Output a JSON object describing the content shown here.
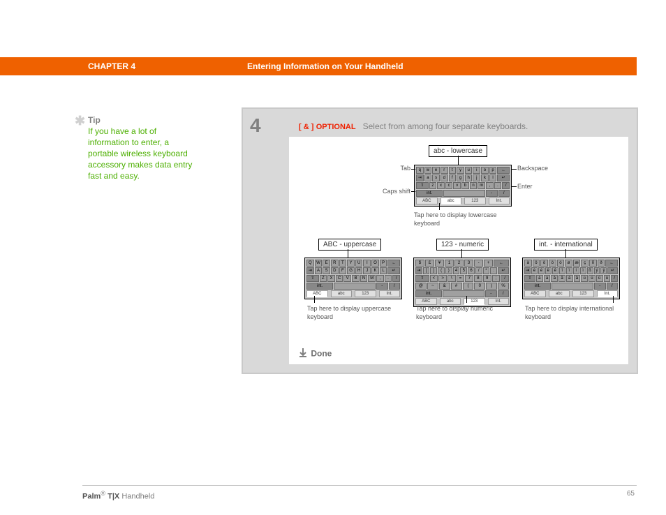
{
  "header": {
    "chapter": "CHAPTER 4",
    "title": "Entering Information on Your Handheld"
  },
  "tip": {
    "heading": "Tip",
    "body": "If you have a lot of information to enter, a portable wireless keyboard accessory makes data entry fast and easy."
  },
  "step": {
    "number": "4",
    "opt_bracket": "[ & ]",
    "opt_word": "OPTIONAL",
    "opt_text": "Select from among four separate keyboards.",
    "done": "Done"
  },
  "labels": {
    "lowercase": "abc - lowercase",
    "uppercase": "ABC - uppercase",
    "numeric": "123 - numeric",
    "international": "int. - international",
    "tab": "Tab",
    "backspace": "Backspace",
    "caps": "Caps shift",
    "enter": "Enter"
  },
  "captions": {
    "lowercase": "Tap here to display lowercase keyboard",
    "uppercase": "Tap here to display uppercase keyboard",
    "numeric": "Tap here to display numeric keyboard",
    "international": "Tap here to display international keyboard"
  },
  "keyboards": {
    "lowercase": {
      "rows": [
        [
          "q",
          "w",
          "e",
          "r",
          "t",
          "y",
          "u",
          "i",
          "o",
          "p"
        ],
        [
          "a",
          "s",
          "d",
          "f",
          "g",
          "h",
          "j",
          "k",
          "l"
        ],
        [
          "z",
          "x",
          "c",
          "v",
          "b",
          "n",
          "m",
          ",",
          "."
        ]
      ],
      "tabs": [
        "ABC",
        "abc",
        "123",
        "Int."
      ]
    },
    "uppercase": {
      "rows": [
        [
          "Q",
          "W",
          "E",
          "R",
          "T",
          "Y",
          "U",
          "I",
          "O",
          "P"
        ],
        [
          "A",
          "S",
          "D",
          "F",
          "G",
          "H",
          "J",
          "K",
          "L"
        ],
        [
          "Z",
          "X",
          "C",
          "V",
          "B",
          "N",
          "M",
          ",",
          "."
        ]
      ],
      "tabs": [
        "ABC",
        "abc",
        "123",
        "Int."
      ]
    },
    "numeric": {
      "rows": [
        [
          "$",
          "£",
          "¥",
          "1",
          "2",
          "3",
          "-",
          "+"
        ],
        [
          "[",
          "]",
          "(",
          ")",
          "4",
          "5",
          "6",
          "/",
          "*",
          ":"
        ],
        [
          "<",
          ">",
          "\\",
          "=",
          "7",
          "8",
          "9",
          ";"
        ],
        [
          "@",
          "~",
          "&",
          "#",
          "(",
          "0",
          ")",
          "%"
        ]
      ],
      "tabs": [
        "ABC",
        "abc",
        "123",
        "Int."
      ]
    },
    "international": {
      "rows": [
        [
          "à",
          "ô",
          "ö",
          "ò",
          "ó",
          "ø",
          "æ",
          "ç",
          "ñ",
          "ð"
        ],
        [
          "è",
          "é",
          "ë",
          "ê",
          "î",
          "ï",
          "í",
          "ì",
          "ß",
          "ý",
          "ÿ"
        ],
        [
          "à",
          "á",
          "â",
          "ã",
          "ä",
          "å",
          "ù",
          "ú",
          "û",
          "ü"
        ]
      ],
      "tabs": [
        "ABC",
        "abc",
        "123",
        "Int."
      ]
    }
  },
  "footer": {
    "brand": "Palm",
    "model": "T|X",
    "product": "Handheld",
    "page": "65"
  }
}
